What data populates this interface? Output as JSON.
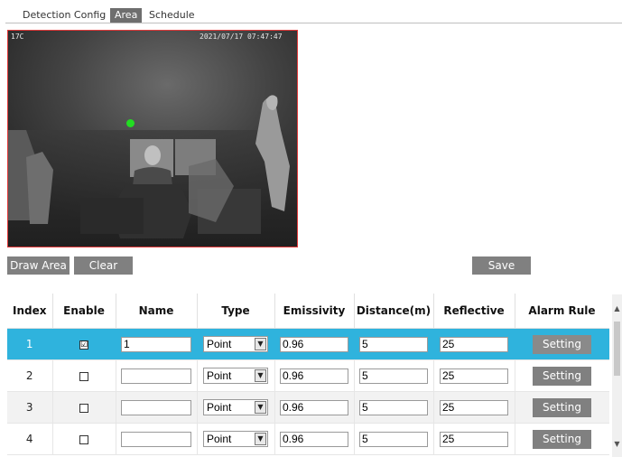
{
  "tabs": [
    "Detection Config",
    "Area",
    "Schedule"
  ],
  "active_tab": "Area",
  "video": {
    "osd_left": "17C",
    "osd_timestamp": "2021/07/17 07:47:47"
  },
  "buttons": {
    "draw_area": "Draw Area",
    "clear": "Clear",
    "save": "Save"
  },
  "table": {
    "headers": [
      "Index",
      "Enable",
      "Name",
      "Type",
      "Emissivity",
      "Distance(m)",
      "Reflective",
      "Alarm Rule"
    ],
    "rows": [
      {
        "index": "1",
        "enabled": true,
        "name": "1",
        "type": "Point",
        "emissivity": "0.96",
        "distance": "5",
        "reflective": "25",
        "rule": "Setting"
      },
      {
        "index": "2",
        "enabled": false,
        "name": "",
        "type": "Point",
        "emissivity": "0.96",
        "distance": "5",
        "reflective": "25",
        "rule": "Setting"
      },
      {
        "index": "3",
        "enabled": false,
        "name": "",
        "type": "Point",
        "emissivity": "0.96",
        "distance": "5",
        "reflective": "25",
        "rule": "Setting"
      },
      {
        "index": "4",
        "enabled": false,
        "name": "",
        "type": "Point",
        "emissivity": "0.96",
        "distance": "5",
        "reflective": "25",
        "rule": "Setting"
      }
    ]
  },
  "colors": {
    "selected_row": "#2fb3dd",
    "video_border": "#e23a3a",
    "point_marker": "#22dd22",
    "button": "#808080"
  },
  "icons": {
    "checkbox_checked": "☑",
    "dropdown_arrow": "▼",
    "scroll_up": "▲",
    "scroll_down": "▼"
  }
}
